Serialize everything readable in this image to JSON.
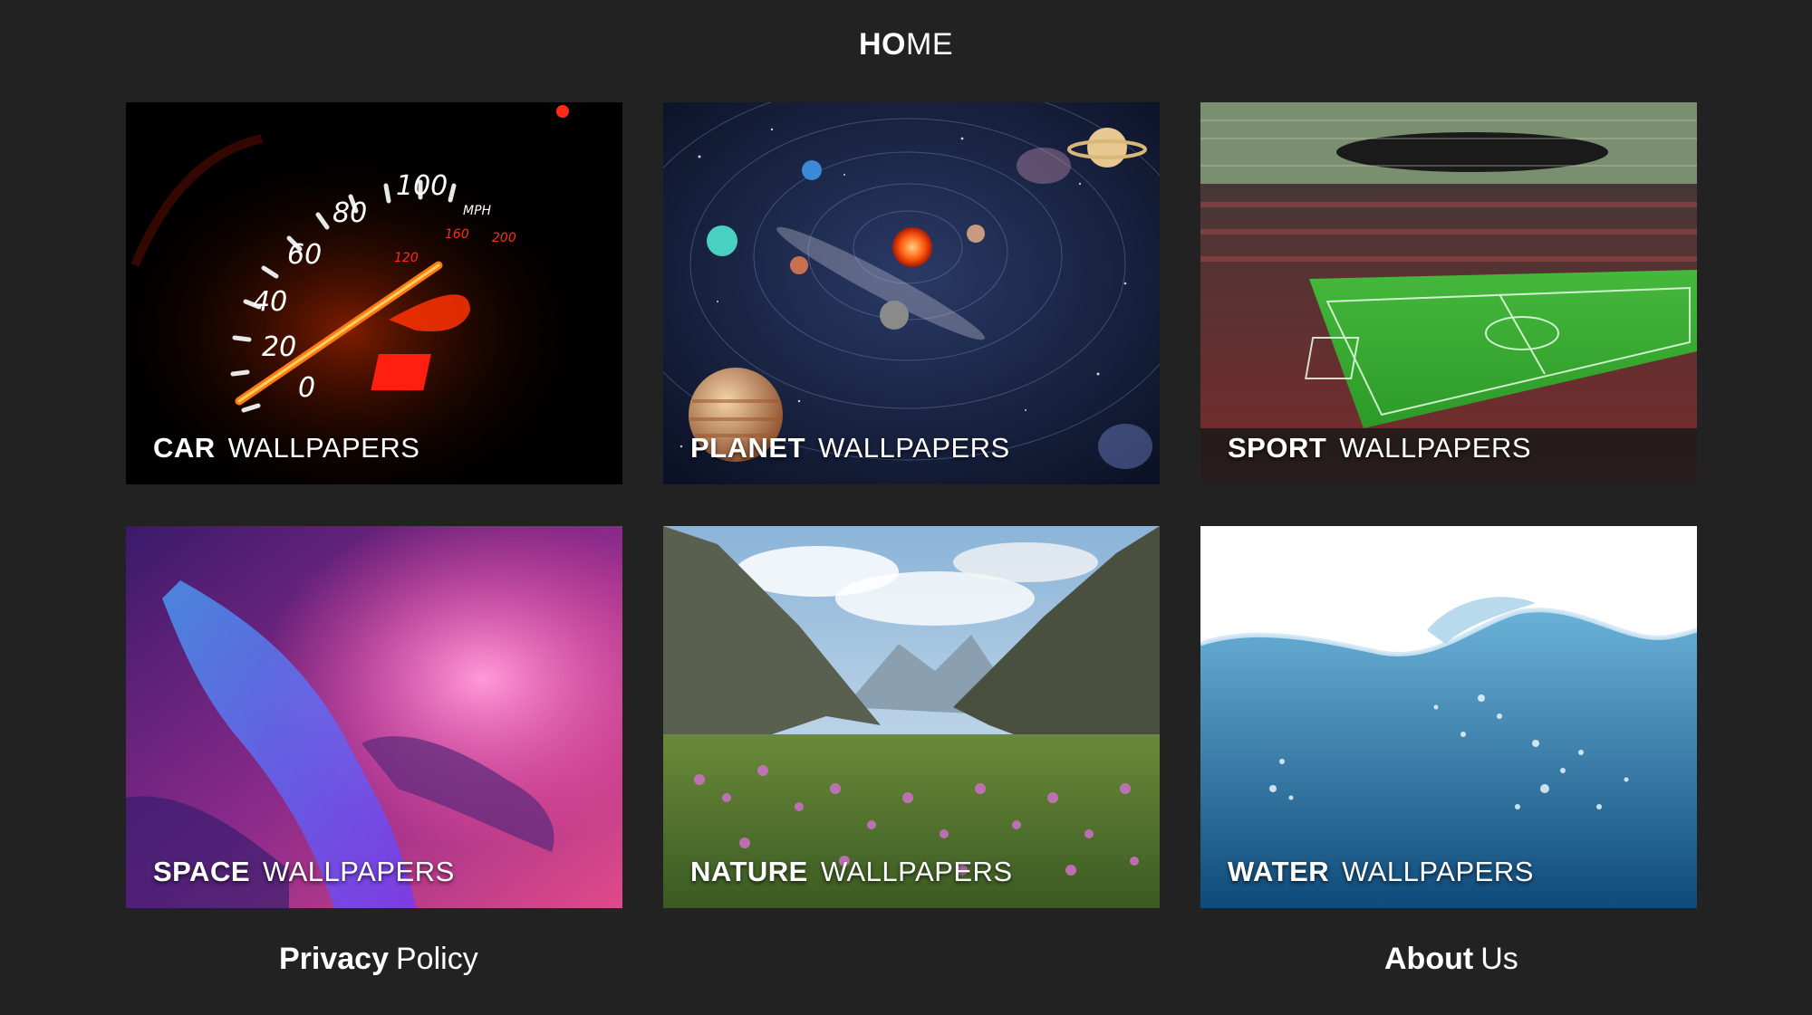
{
  "header": {
    "title_bold": "HO",
    "title_rest": "ME"
  },
  "tiles": [
    {
      "bold": "CAR",
      "thin": "WALLPAPERS",
      "image": "speedometer"
    },
    {
      "bold": "PLANET",
      "thin": "WALLPAPERS",
      "image": "solar-system"
    },
    {
      "bold": "SPORT",
      "thin": "WALLPAPERS",
      "image": "football-stadium"
    },
    {
      "bold": "SPACE",
      "thin": "WALLPAPERS",
      "image": "pink-blue-nebula"
    },
    {
      "bold": "NATURE",
      "thin": "WALLPAPERS",
      "image": "mountain-valley-flowers"
    },
    {
      "bold": "WATER",
      "thin": "WALLPAPERS",
      "image": "water-splash"
    }
  ],
  "speedometer": {
    "ticks": [
      "0",
      "20",
      "40",
      "60",
      "80",
      "100"
    ],
    "unit": "MPH",
    "inner_ticks": [
      "120",
      "160",
      "200"
    ]
  },
  "footer": {
    "privacy_bold": "Privacy",
    "privacy_rest": "Policy",
    "about_bold": "About",
    "about_rest": "Us"
  }
}
